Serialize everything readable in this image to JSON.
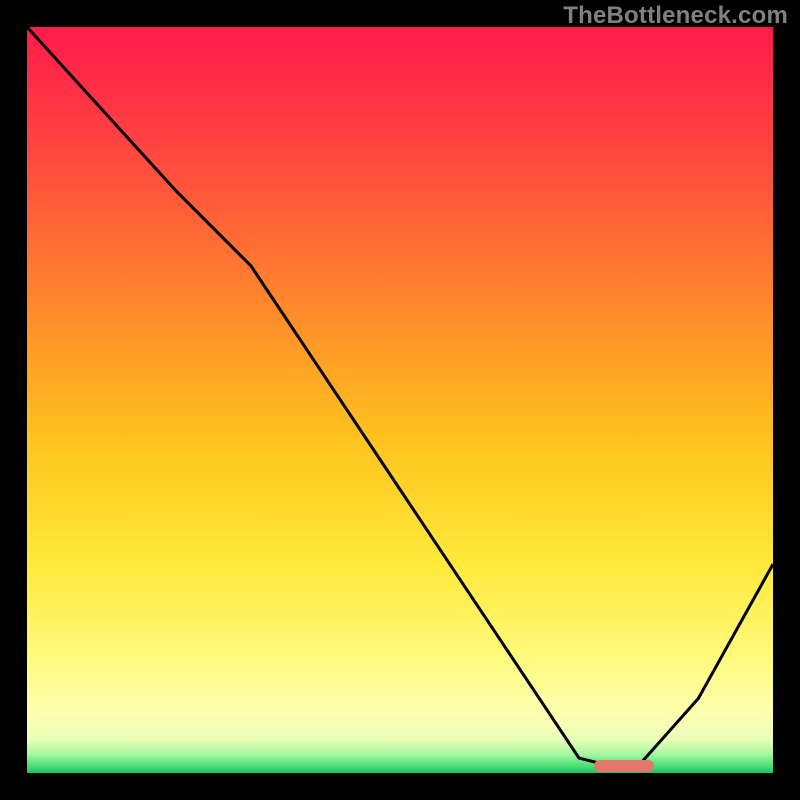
{
  "watermark": "TheBottleneck.com",
  "chart_data": {
    "type": "line",
    "title": "",
    "xlabel": "",
    "ylabel": "",
    "xlim": [
      0,
      100
    ],
    "ylim": [
      0,
      100
    ],
    "grid": false,
    "legend": false,
    "gradient_stops": [
      {
        "offset": 0,
        "color": "#ff1a4b"
      },
      {
        "offset": 0.18,
        "color": "#ff4a3f"
      },
      {
        "offset": 0.38,
        "color": "#ff8a2a"
      },
      {
        "offset": 0.55,
        "color": "#ffc21e"
      },
      {
        "offset": 0.72,
        "color": "#ffe93a"
      },
      {
        "offset": 0.84,
        "color": "#fff97a"
      },
      {
        "offset": 0.92,
        "color": "#ffffb0"
      },
      {
        "offset": 0.955,
        "color": "#e9ffb8"
      },
      {
        "offset": 0.975,
        "color": "#a6f7a0"
      },
      {
        "offset": 0.99,
        "color": "#4be077"
      },
      {
        "offset": 1.0,
        "color": "#18c560"
      }
    ],
    "series": [
      {
        "name": "bottleneck-curve",
        "color": "#000000",
        "x": [
          0,
          10,
          20,
          30,
          40,
          50,
          60,
          70,
          74,
          78,
          82,
          90,
          100
        ],
        "y": [
          100,
          89,
          78,
          68,
          53,
          38,
          23,
          8,
          2,
          1,
          1,
          10,
          28
        ]
      }
    ],
    "optimum_marker": {
      "x_start": 76,
      "x_end": 84,
      "y": 1,
      "color": "#e2786c"
    }
  }
}
